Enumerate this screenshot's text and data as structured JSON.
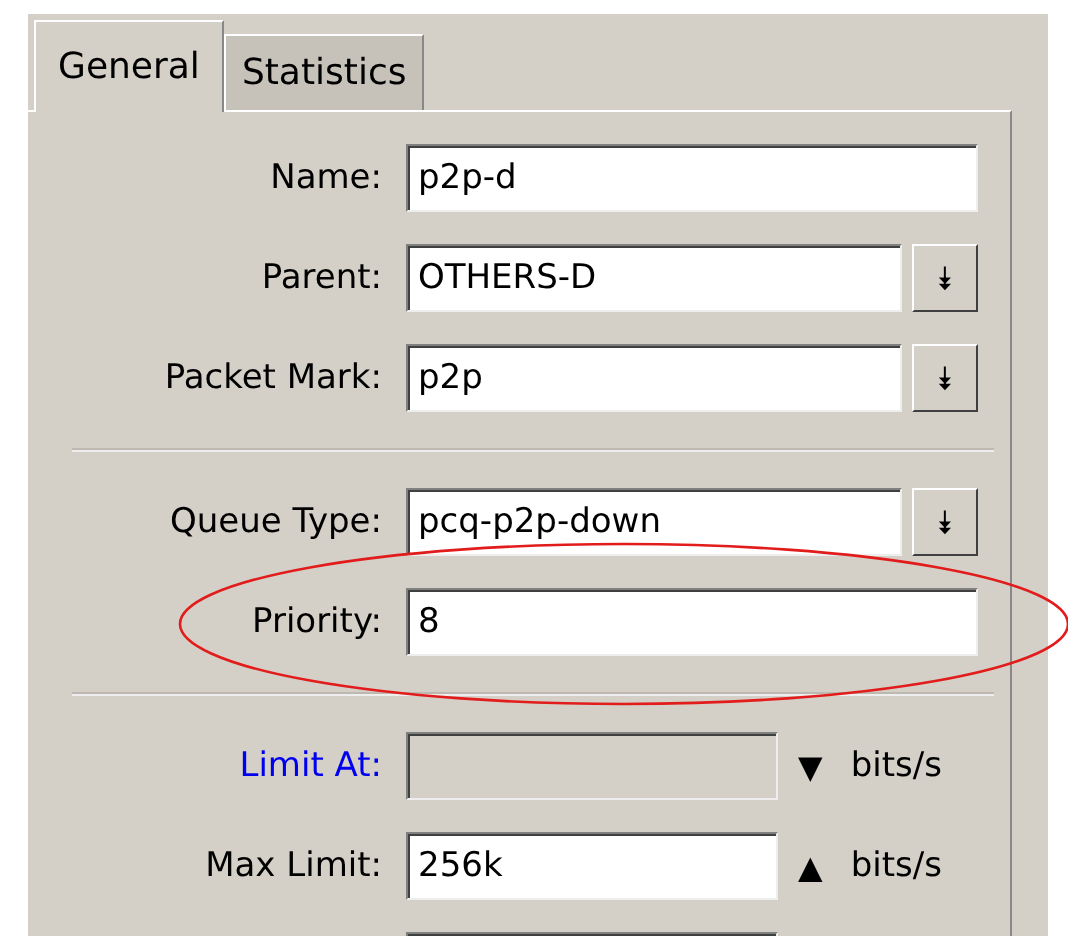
{
  "tabs": [
    {
      "label": "General",
      "selected": true
    },
    {
      "label": "Statistics",
      "selected": false
    }
  ],
  "sections": [
    {
      "rows": [
        {
          "kind": "text",
          "label": "Name:",
          "value": "p2p-d"
        },
        {
          "kind": "select",
          "label": "Parent:",
          "value": "OTHERS-D",
          "button": "⯯"
        },
        {
          "kind": "select",
          "label": "Packet Mark:",
          "value": "p2p",
          "button": "⯯"
        }
      ]
    },
    {
      "rows": [
        {
          "kind": "select",
          "label": "Queue Type:",
          "value": "pcq-p2p-down",
          "button": "⯯"
        },
        {
          "kind": "text",
          "label": "Priority:",
          "value": "8"
        }
      ]
    },
    {
      "rows": [
        {
          "kind": "unit",
          "label": "Limit At:",
          "disabled": true,
          "highlighted": true,
          "toggle": "▼",
          "unit": "bits/s"
        },
        {
          "kind": "unit",
          "label": "Max Limit:",
          "value": "256k",
          "disabled": false,
          "highlighted": false,
          "toggle": "▲",
          "unit": "bits/s"
        }
      ]
    }
  ]
}
